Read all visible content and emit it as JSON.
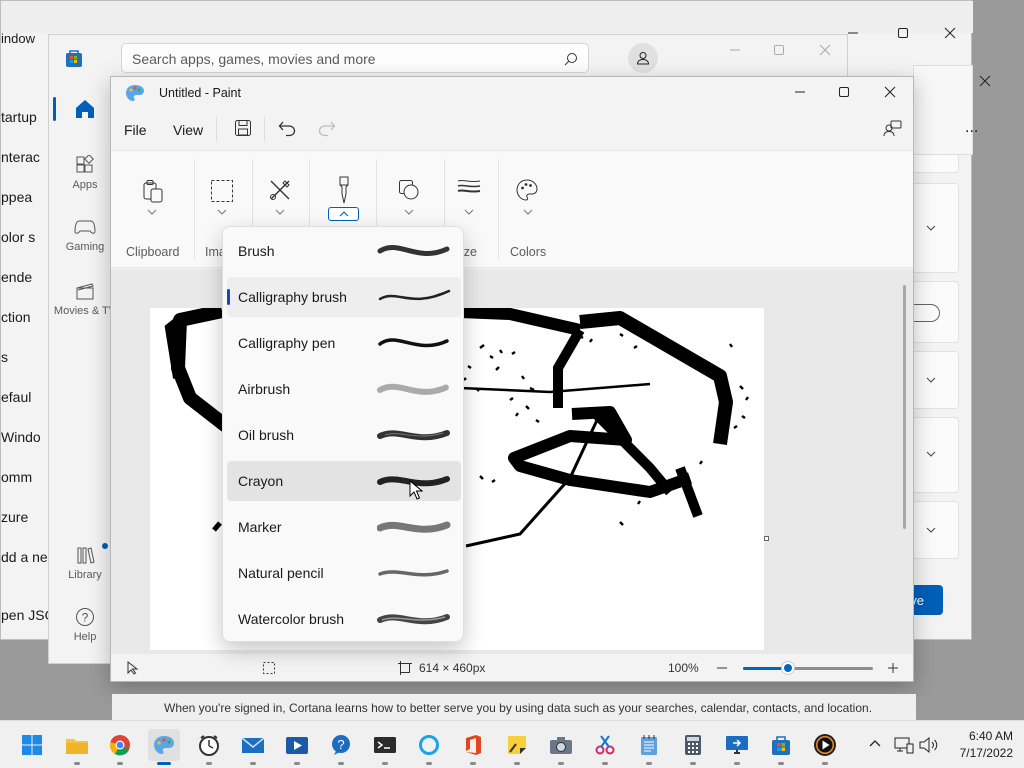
{
  "settings": {
    "title_fragment": "indow",
    "left_items": [
      "tartup",
      "nterac",
      "ppea",
      "olor s",
      "ende",
      "ction",
      "s",
      "efaul",
      "Windo",
      "omm",
      "zure",
      "dd a ne",
      "pen JSO"
    ],
    "save_label": "ave",
    "more_label": "..."
  },
  "store": {
    "search_placeholder": "Search apps, games, movies and more",
    "nav": [
      {
        "label": "",
        "icon": "home-icon"
      },
      {
        "label": "Apps",
        "icon": "apps-icon"
      },
      {
        "label": "Gaming",
        "icon": "gamepad-icon"
      },
      {
        "label": "Movies & TV",
        "icon": "clapperboard-icon"
      },
      {
        "label": "Library",
        "icon": "library-icon"
      },
      {
        "label": "Help",
        "icon": "help-icon"
      }
    ]
  },
  "paint": {
    "title": "Untitled - Paint",
    "menu": {
      "file": "File",
      "view": "View"
    },
    "groups": {
      "clipboard": "Clipboard",
      "image": "Ima",
      "size": "ize",
      "colors": "Colors"
    },
    "brushes": [
      {
        "label": "Brush"
      },
      {
        "label": "Calligraphy brush"
      },
      {
        "label": "Calligraphy pen"
      },
      {
        "label": "Airbrush"
      },
      {
        "label": "Oil brush"
      },
      {
        "label": "Crayon"
      },
      {
        "label": "Marker"
      },
      {
        "label": "Natural pencil"
      },
      {
        "label": "Watercolor brush"
      }
    ],
    "selected_brush": "Calligraphy brush",
    "hovered_brush": "Crayon",
    "status": {
      "canvas_size": "614 × 460px",
      "zoom": "100%",
      "zoom_level": 0.35
    }
  },
  "cortana_text": "When you're signed in, Cortana learns how to better serve you by using data such as your searches, calendar, contacts, and location.",
  "taskbar": {
    "apps": [
      "start-icon",
      "file-explorer-icon",
      "chrome-icon",
      "paint-icon",
      "clock-icon",
      "mail-icon",
      "movies-icon",
      "get-help-icon",
      "terminal-icon",
      "cortana-icon",
      "office-icon",
      "sticky-notes-icon",
      "camera-icon",
      "snipping-tool-icon",
      "notepad-icon",
      "calculator-icon",
      "remote-desktop-icon",
      "store-icon",
      "media-player-icon"
    ],
    "time": "6:40 AM",
    "date": "7/17/2022"
  },
  "colors": {
    "accent": "#005fb8",
    "zoom_accent": "#0067c0"
  }
}
